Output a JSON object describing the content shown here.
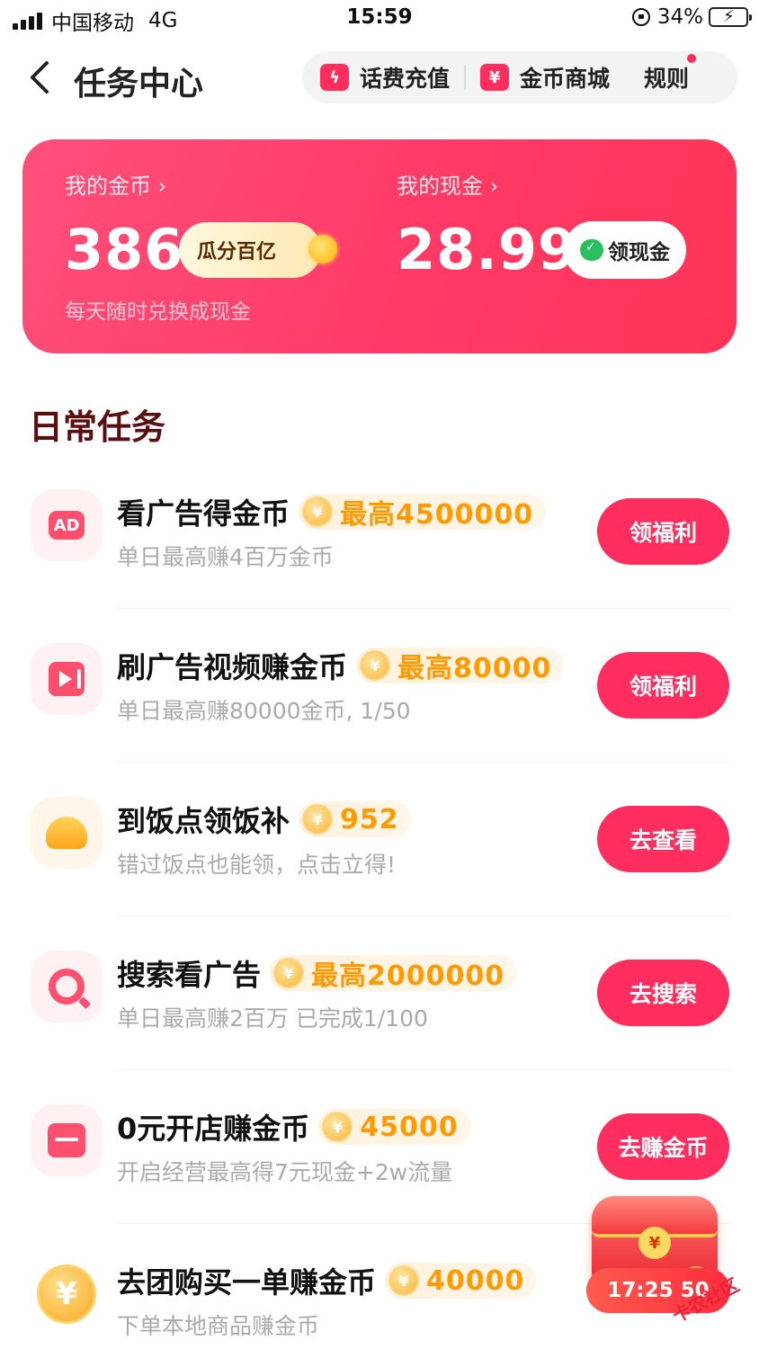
{
  "status_bar": {
    "carrier": "中国移动",
    "network": "4G",
    "time": "15:59",
    "battery": "34%"
  },
  "nav": {
    "title": "任务中心",
    "recharge": "话费充值",
    "mall": "金币商城",
    "rules": "规则"
  },
  "wallet": {
    "coins_label": "我的金币",
    "coins_value": "386",
    "coins_badge": "瓜分百亿",
    "cash_label": "我的现金",
    "cash_value": "28.99",
    "cash_button": "领现金",
    "subtitle": "每天随时兑换成现金"
  },
  "section_title": "日常任务",
  "tasks": [
    {
      "title": "看广告得金币",
      "reward": "最高4500000",
      "sub": "单日最高赚4百万金币",
      "button": "领福利",
      "icon": "ad-icon",
      "badge": "AD"
    },
    {
      "title": "刷广告视频赚金币",
      "reward": "最高80000",
      "sub": "单日最高赚80000金币, 1/50",
      "button": "领福利",
      "icon": "video-icon"
    },
    {
      "title": "到饭点领饭补",
      "reward": "952",
      "sub": "错过饭点也能领，点击立得!",
      "button": "去查看",
      "icon": "bowl-icon"
    },
    {
      "title": "搜索看广告",
      "reward": "最高2000000",
      "sub": "单日最高赚2百万 已完成1/100",
      "button": "去搜索",
      "icon": "search-icon"
    },
    {
      "title": "0元开店赚金币",
      "reward": "45000",
      "sub": "开启经营最高得7元现金+2w流量",
      "button": "去赚金币",
      "icon": "shop-icon"
    },
    {
      "title": "去团购买一单赚金币",
      "reward": "40000",
      "sub": "下单本地商品赚金币",
      "button": "",
      "icon": "yuan-coin-icon",
      "symbol": "¥"
    }
  ],
  "chest": {
    "countdown": "17:25 50",
    "watermark": "卡农社区"
  },
  "colors": {
    "accent": "#ff2e5e",
    "reward": "#ff9a00",
    "section_title": "#5a0f0f"
  }
}
